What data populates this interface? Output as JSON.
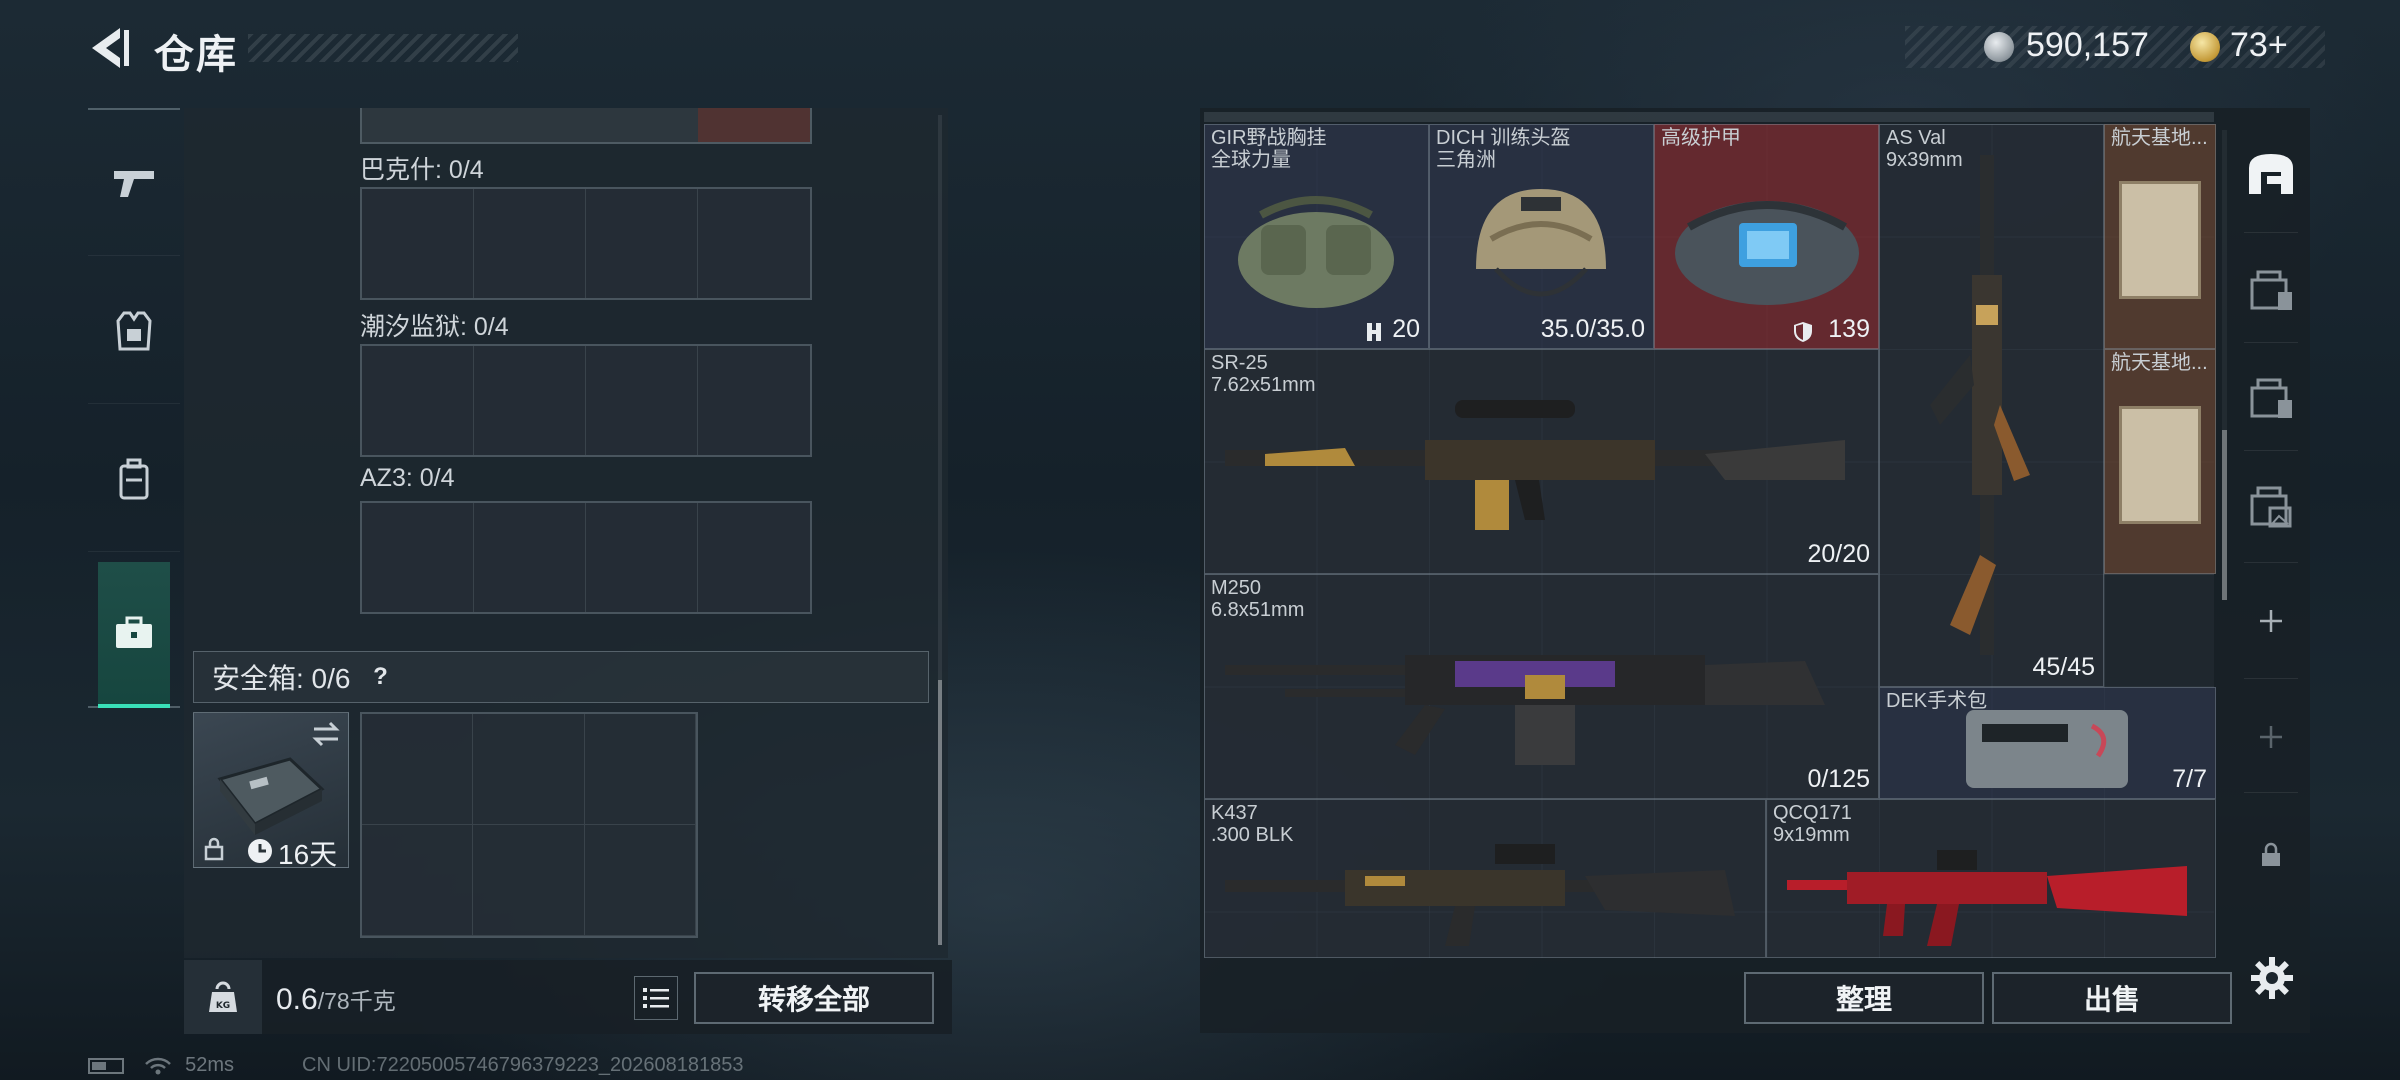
{
  "header": {
    "title": "仓库"
  },
  "currency": {
    "silver": "590,157",
    "gold": "73+"
  },
  "nav": {
    "items": [
      "weapons",
      "armor",
      "backpack",
      "safe-box"
    ]
  },
  "stash": {
    "sections": [
      {
        "label": "巴克什: 0/4"
      },
      {
        "label": "潮汐监狱: 0/4"
      },
      {
        "label": "AZ3: 0/4"
      }
    ],
    "safe_box": {
      "label": "安全箱: 0/6",
      "help": "?",
      "timer": "16天"
    }
  },
  "weight": {
    "current": "0.6",
    "max": "/78千克",
    "icon_label": "KG"
  },
  "buttons": {
    "transfer_all": "转移全部",
    "sort": "整理",
    "sell": "出售"
  },
  "status": {
    "ping": "52ms",
    "uid": "CN UID:7220500574679637922​3_202608181853"
  },
  "inventory": {
    "items": [
      {
        "name": "GIR野战胸挂",
        "sub": "全球力量",
        "value": "20"
      },
      {
        "name": "DICH 训练头盔",
        "sub": "三角洲",
        "value": "35.0/35.0"
      },
      {
        "name": "高级护甲",
        "sub": "",
        "value": "139"
      },
      {
        "name": "AS Val",
        "sub": "9x39mm",
        "value": "45/45"
      },
      {
        "name": "航天基地...",
        "sub": "",
        "value": ""
      },
      {
        "name": "航天基地...",
        "sub": "",
        "value": ""
      },
      {
        "name": "SR-25",
        "sub": "7.62x51mm",
        "value": "20/20"
      },
      {
        "name": "M250",
        "sub": "6.8x51mm",
        "value": "0/125"
      },
      {
        "name": "DEK手术包",
        "sub": "",
        "value": "7/7"
      },
      {
        "name": "K437",
        "sub": ".300 BLK",
        "value": ""
      },
      {
        "name": "QCQ171",
        "sub": "9x19mm",
        "value": ""
      }
    ]
  }
}
